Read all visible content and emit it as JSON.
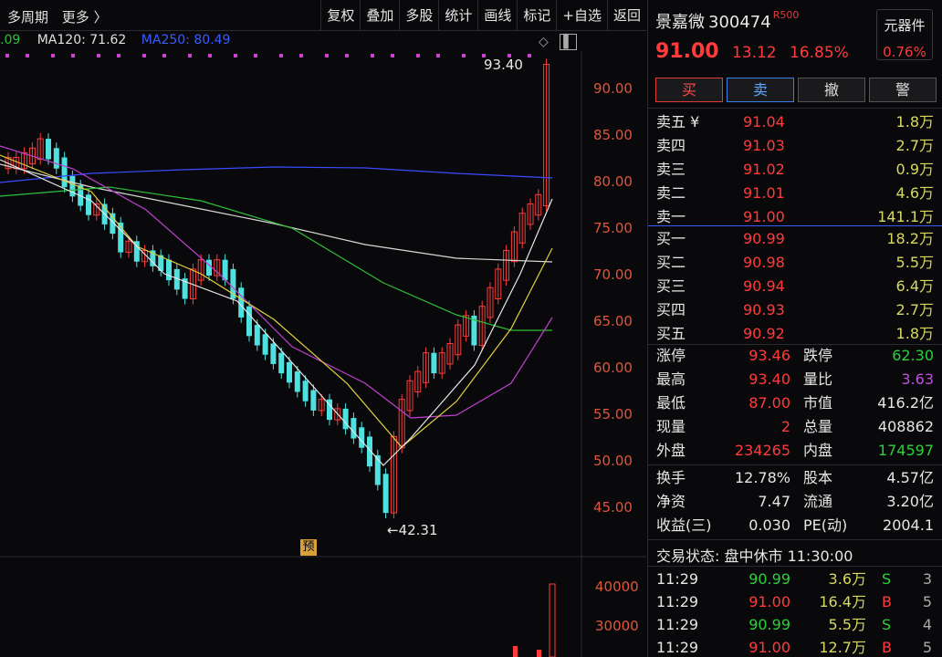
{
  "toolbar": {
    "period": "多周期",
    "more": "更多 〉",
    "buttons": [
      "复权",
      "叠加",
      "多股",
      "统计",
      "画线",
      "标记",
      "+自选",
      "返回"
    ]
  },
  "ma": {
    "ma_partial": ".09",
    "ma120": "MA120: 71.62",
    "ma250": "MA250: 80.49"
  },
  "chart": {
    "price_ticks": [
      "90.00",
      "85.00",
      "80.00",
      "75.00",
      "70.00",
      "65.00",
      "60.00",
      "55.00",
      "50.00",
      "45.00"
    ],
    "high_label": "93.40",
    "low_label": "←42.31",
    "pre_badge": "预",
    "volume_ticks": [
      "40000",
      "30000"
    ]
  },
  "stock": {
    "name": "景嘉微",
    "code": "300474",
    "tag": "R500",
    "price": "91.00",
    "change": "13.12",
    "pct": "16.85%",
    "sector": "元器件",
    "sector_pct": "0.76%"
  },
  "trade": {
    "buy": "买",
    "sell": "卖",
    "cancel": "撤",
    "alert": "警"
  },
  "asks": [
    {
      "label": "卖五 ¥",
      "price": "91.04",
      "vol": "1.8万"
    },
    {
      "label": "卖四",
      "price": "91.03",
      "vol": "2.7万"
    },
    {
      "label": "卖三",
      "price": "91.02",
      "vol": "0.9万"
    },
    {
      "label": "卖二",
      "price": "91.01",
      "vol": "4.6万"
    },
    {
      "label": "卖一",
      "price": "91.00",
      "vol": "141.1万"
    }
  ],
  "bids": [
    {
      "label": "买一",
      "price": "90.99",
      "vol": "18.2万"
    },
    {
      "label": "买二",
      "price": "90.98",
      "vol": "5.5万"
    },
    {
      "label": "买三",
      "price": "90.94",
      "vol": "6.4万"
    },
    {
      "label": "买四",
      "price": "90.93",
      "vol": "2.7万"
    },
    {
      "label": "买五",
      "price": "90.92",
      "vol": "1.8万"
    }
  ],
  "stats1": [
    {
      "l1": "涨停",
      "v1": "93.46",
      "c1": "red",
      "l2": "跌停",
      "v2": "62.30",
      "c2": "green"
    },
    {
      "l1": "最高",
      "v1": "93.40",
      "c1": "red",
      "l2": "量比",
      "v2": "3.63",
      "c2": "purple"
    },
    {
      "l1": "最低",
      "v1": "87.00",
      "c1": "red",
      "l2": "市值",
      "v2": "416.2亿",
      "c2": "white"
    },
    {
      "l1": "现量",
      "v1": "2",
      "c1": "red",
      "l2": "总量",
      "v2": "408862",
      "c2": "white"
    },
    {
      "l1": "外盘",
      "v1": "234265",
      "c1": "red",
      "l2": "内盘",
      "v2": "174597",
      "c2": "green"
    }
  ],
  "stats2": [
    {
      "l1": "换手",
      "v1": "12.78%",
      "c1": "white",
      "l2": "股本",
      "v2": "4.57亿",
      "c2": "white"
    },
    {
      "l1": "净资",
      "v1": "7.47",
      "c1": "white",
      "l2": "流通",
      "v2": "3.20亿",
      "c2": "white"
    },
    {
      "l1": "收益(三)",
      "v1": "0.030",
      "c1": "white",
      "l2": "PE(动)",
      "v2": "2004.1",
      "c2": "white"
    }
  ],
  "status": "交易状态: 盘中休市 11:30:00",
  "ticks": [
    {
      "t": "11:29",
      "p": "90.99",
      "pc": "green",
      "v": "3.6万",
      "d": "S",
      "dc": "green",
      "c": "3"
    },
    {
      "t": "11:29",
      "p": "91.00",
      "pc": "red",
      "v": "16.4万",
      "d": "B",
      "dc": "red",
      "c": "5"
    },
    {
      "t": "11:29",
      "p": "90.99",
      "pc": "green",
      "v": "5.5万",
      "d": "S",
      "dc": "green",
      "c": "4"
    },
    {
      "t": "11:29",
      "p": "91.00",
      "pc": "red",
      "v": "12.7万",
      "d": "B",
      "dc": "red",
      "c": "5"
    }
  ]
}
